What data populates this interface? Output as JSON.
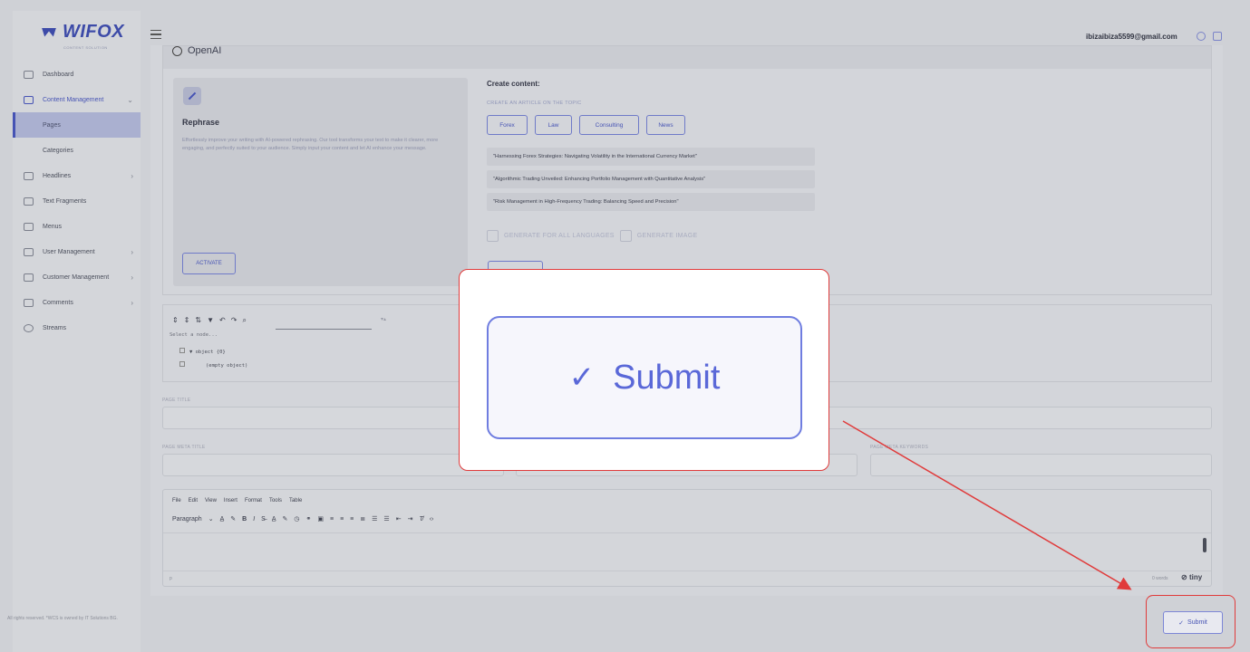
{
  "sidebar": {
    "logo": "WIFOX",
    "logo_sub": "CONTENT SOLUTION",
    "items": [
      {
        "label": "Dashboard"
      },
      {
        "label": "Content Management"
      },
      {
        "label": "Headlines"
      },
      {
        "label": "Text Fragments"
      },
      {
        "label": "Menus"
      },
      {
        "label": "User Management"
      },
      {
        "label": "Customer Management"
      },
      {
        "label": "Comments"
      },
      {
        "label": "Streams"
      }
    ],
    "sub_items": [
      {
        "label": "Pages"
      },
      {
        "label": "Categories"
      }
    ],
    "footer": "All rights reserved. *WCS is owned by IT Solutions BG."
  },
  "topbar": {
    "email": "ibizaibiza5599@gmail.com"
  },
  "openai": {
    "title": "OpenAI",
    "rephrase": {
      "title": "Rephrase",
      "description": "Effortlessly improve your writing with AI-powered rephrasing. Our tool transforms your text to make it clearer, more engaging, and perfectly suited to your audience. Simply input your content and let AI enhance your message.",
      "activate_label": "ACTIVATE"
    },
    "create": {
      "title": "Create content:",
      "subtitle": "CREATE AN ARTICLE ON THE TOPIC",
      "topics": [
        "Forex",
        "Law",
        "Consulting",
        "News"
      ],
      "suggestions": [
        "\"Harnessing Forex Strategies: Navigating Volatility in the International Currency Market\"",
        "\"Algorithmic Trading Unveiled: Enhancing Portfolio Management with Quantitative Analysis\"",
        "\"Risk Management in High-Frequency Trading: Balancing Speed and Precision\""
      ],
      "generate_all_label": "GENERATE FOR ALL LANGUAGES",
      "generate_image_label": "GENERATE IMAGE"
    }
  },
  "json_editor": {
    "select_node": "Select a node...",
    "row1": "▼ object {0}",
    "row2": "(empty object)"
  },
  "fields": {
    "page_title_label": "PAGE TITLE",
    "page_meta_title_label": "PAGE META TITLE",
    "page_meta_keywords_label": "PAGE META KEYWORDS"
  },
  "editor": {
    "menu": [
      "File",
      "Edit",
      "View",
      "Insert",
      "Format",
      "Tools",
      "Table"
    ],
    "paragraph_label": "Paragraph",
    "path": "p",
    "word_count": "0 words",
    "brand": "tiny"
  },
  "submit": {
    "label": "Submit",
    "check": "✓"
  },
  "colors": {
    "accent": "#4653b4",
    "highlight": "#e03b3b"
  }
}
